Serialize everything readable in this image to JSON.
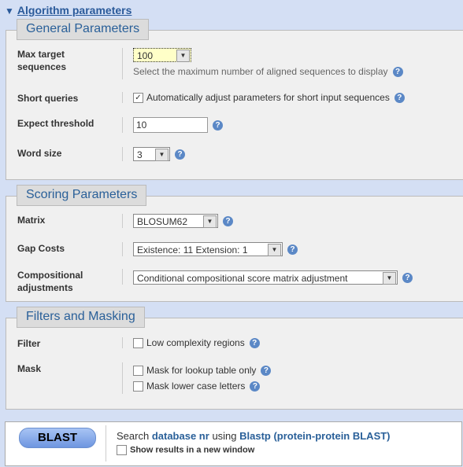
{
  "header": {
    "title": "Algorithm parameters"
  },
  "general": {
    "title": "General Parameters",
    "max_target": {
      "label": "Max target sequences",
      "value": "100",
      "hint": "Select the maximum number of aligned sequences to display"
    },
    "short_queries": {
      "label": "Short queries",
      "checkbox": "Automatically adjust parameters for short input sequences",
      "checked": true
    },
    "expect": {
      "label": "Expect threshold",
      "value": "10"
    },
    "word_size": {
      "label": "Word size",
      "value": "3"
    }
  },
  "scoring": {
    "title": "Scoring Parameters",
    "matrix": {
      "label": "Matrix",
      "value": "BLOSUM62"
    },
    "gap": {
      "label": "Gap Costs",
      "value": "Existence: 11 Extension: 1"
    },
    "comp": {
      "label": "Compositional adjustments",
      "value": "Conditional compositional score matrix adjustment"
    }
  },
  "filters": {
    "title": "Filters and Masking",
    "filter": {
      "label": "Filter",
      "low": "Low complexity regions"
    },
    "mask": {
      "label": "Mask",
      "lookup": "Mask for lookup table only",
      "lower": "Mask lower case letters"
    }
  },
  "blast": {
    "button": "BLAST",
    "search": "Search",
    "db": "database nr",
    "using": "using",
    "program": "Blastp (protein-protein BLAST)",
    "new_window": "Show results in a new window"
  },
  "help_icon": "?"
}
